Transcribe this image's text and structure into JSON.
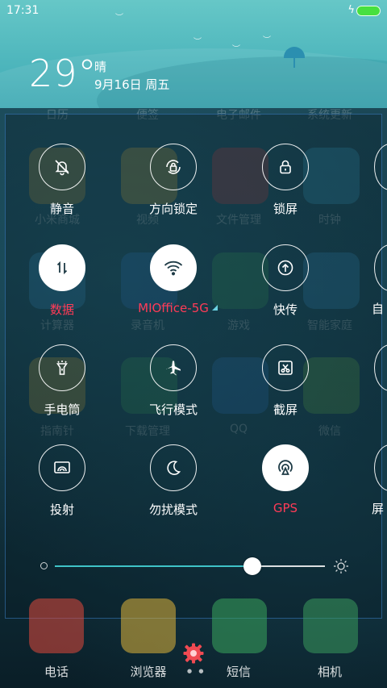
{
  "status_bar": {
    "time": "17:31"
  },
  "weather": {
    "temperature": "29°",
    "condition": "晴",
    "date": "9月16日 周五"
  },
  "background_apps": {
    "row_labels_1": [
      "日历",
      "便签",
      "电子邮件",
      "系统更新"
    ],
    "row_labels_2": [
      "小米商城",
      "视频",
      "文件管理",
      "时钟"
    ],
    "row_labels_3": [
      "计算器",
      "录音机",
      "游戏",
      "智能家庭"
    ],
    "row_labels_4": [
      "指南针",
      "下载管理",
      "QQ",
      "微信"
    ]
  },
  "toggles": [
    {
      "label": "静音",
      "icon": "mute-bell-icon",
      "active": false
    },
    {
      "label": "方向锁定",
      "icon": "rotation-lock-icon",
      "active": false
    },
    {
      "label": "锁屏",
      "icon": "lock-icon",
      "active": false
    },
    {
      "label": "数据",
      "icon": "mobile-data-icon",
      "active": true
    },
    {
      "label": "MIOffice-5G",
      "icon": "wifi-icon",
      "active": true
    },
    {
      "label": "快传",
      "icon": "mi-drop-icon",
      "active": false
    },
    {
      "label": "手电筒",
      "icon": "flashlight-icon",
      "active": false
    },
    {
      "label": "飞行模式",
      "icon": "airplane-icon",
      "active": false
    },
    {
      "label": "截屏",
      "icon": "screenshot-icon",
      "active": false
    },
    {
      "label": "投射",
      "icon": "cast-icon",
      "active": false
    },
    {
      "label": "勿扰模式",
      "icon": "do-not-disturb-icon",
      "active": false
    },
    {
      "label": "GPS",
      "icon": "gps-icon",
      "active": true
    }
  ],
  "partial_toggles": {
    "row2_label": "自",
    "row4_label": "屏"
  },
  "brightness": {
    "level": 0.73
  },
  "dock": {
    "apps": [
      "电话",
      "浏览器",
      "短信",
      "相机"
    ]
  },
  "colors": {
    "active_label": "#ff3b57",
    "slider_fill": "#3fc3c8",
    "battery": "#47e03f",
    "header_teal": "#4fb7bd"
  }
}
